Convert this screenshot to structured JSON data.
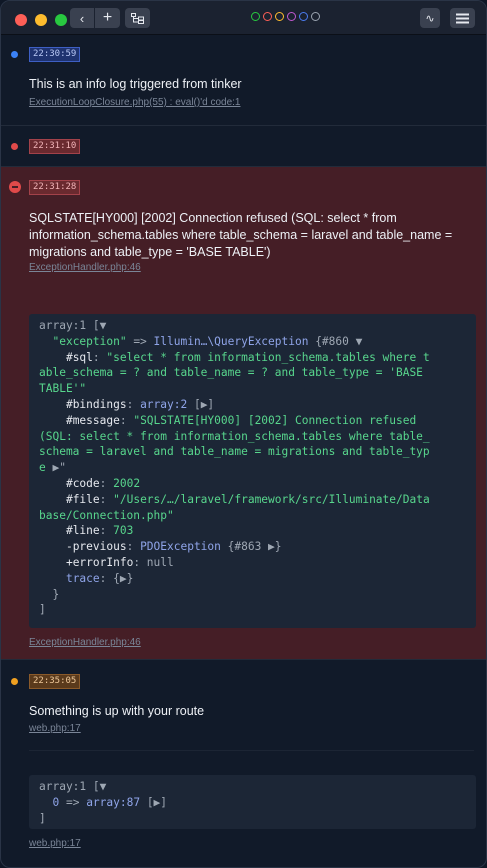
{
  "titlebar": {
    "back_icon": "‹",
    "add_icon": "+",
    "wave_icon": "∿",
    "dots": [
      {
        "color": "#28c840"
      },
      {
        "color": "#fe5f57"
      },
      {
        "color": "#febc2e"
      },
      {
        "color": "#c058d0"
      },
      {
        "color": "#4b7cf0"
      },
      {
        "color": "#9aa3b0"
      }
    ]
  },
  "entries": [
    {
      "type": "info",
      "bullet_color": "#3b82f6",
      "time": "22:30:59",
      "message": "This is an info log triggered from tinker",
      "source": "ExecutionLoopClosure.php(55) : eval()'d code:1"
    },
    {
      "type": "query",
      "bullet_color": "#e04a4a",
      "time": "22:31:10"
    },
    {
      "type": "error",
      "bullet_color": "#e04a4a",
      "time": "22:31:28",
      "message_lines": [
        "SQLSTATE[HY000] [2002] Connection refused (SQL: select * from",
        "information_schema.tables where table_schema = laravel and table_name =",
        "migrations and table_type = 'BASE TABLE')"
      ],
      "source": "ExceptionHandler.php:46",
      "dump": {
        "l1": "array:1",
        "l1b": " [▼",
        "l2k": "\"exception\"",
        "l2a": " => ",
        "l2c": "Illumin…\\QueryException",
        "l2d": " {#860 ▼",
        "l3k": "#sql",
        "l3v": "\"select * from information_schema.tables where t",
        "l4v": "able_schema = ? and table_name = ? and table_type = 'BASE",
        "l5v": "TABLE'\"",
        "l6k": "#bindings",
        "l6v": "array:2",
        "l6b": " [▶]",
        "l7k": "#message",
        "l7v": "\"SQLSTATE[HY000] [2002] Connection refused",
        "l8v": "(SQL: select * from information_schema.tables where table_",
        "l9v": "schema = laravel and table_name = migrations and table_typ",
        "l10v": "e",
        "l10b": " ▶\"",
        "l11k": "#code",
        "l11v": "2002",
        "l12k": "#file",
        "l12v": "\"/Users/…/laravel/framework/src/Illuminate/Data",
        "l13v": "base/Connection.php\"",
        "l14k": "#line",
        "l14v": "703",
        "l15k": "-previous",
        "l15v": "PDOException",
        "l15b": " {#863 ▶}",
        "l16k": "+errorInfo",
        "l16v": "null",
        "l17k": "trace",
        "l17v": " {▶}",
        "l18": "}",
        "l19": "]"
      },
      "source2": "ExceptionHandler.php:46"
    },
    {
      "type": "warning",
      "bullet_color": "#f0a020",
      "time": "22:35:05",
      "message": "Something is up with your route",
      "source": "web.php:17",
      "dump": {
        "l1": "array:1",
        "l1b": " [▼",
        "l2k": "0",
        "l2a": " => ",
        "l2v": "array:87",
        "l2b": " [▶]",
        "l3": "]"
      },
      "source2": "web.php:17"
    }
  ]
}
